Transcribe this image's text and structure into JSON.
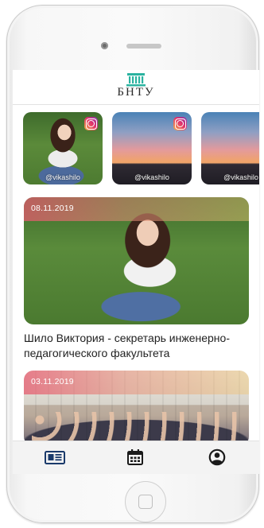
{
  "header": {
    "brand": "БНТУ"
  },
  "stories": [
    {
      "user": "@vikashilo"
    },
    {
      "user": "@vikashilo"
    },
    {
      "user": "@vikashilo"
    }
  ],
  "news": [
    {
      "date": "08.11.2019",
      "title": "Шило Виктория - секретарь инженерно-педагогического факультета"
    },
    {
      "date": "03.11.2019",
      "title": ""
    }
  ],
  "nav": {
    "active_color": "#1a3a6b",
    "icons": [
      "news-icon",
      "calendar-icon",
      "profile-icon"
    ]
  },
  "colors": {
    "logo": "#2bb3a0",
    "instagram": "#e1306c"
  }
}
